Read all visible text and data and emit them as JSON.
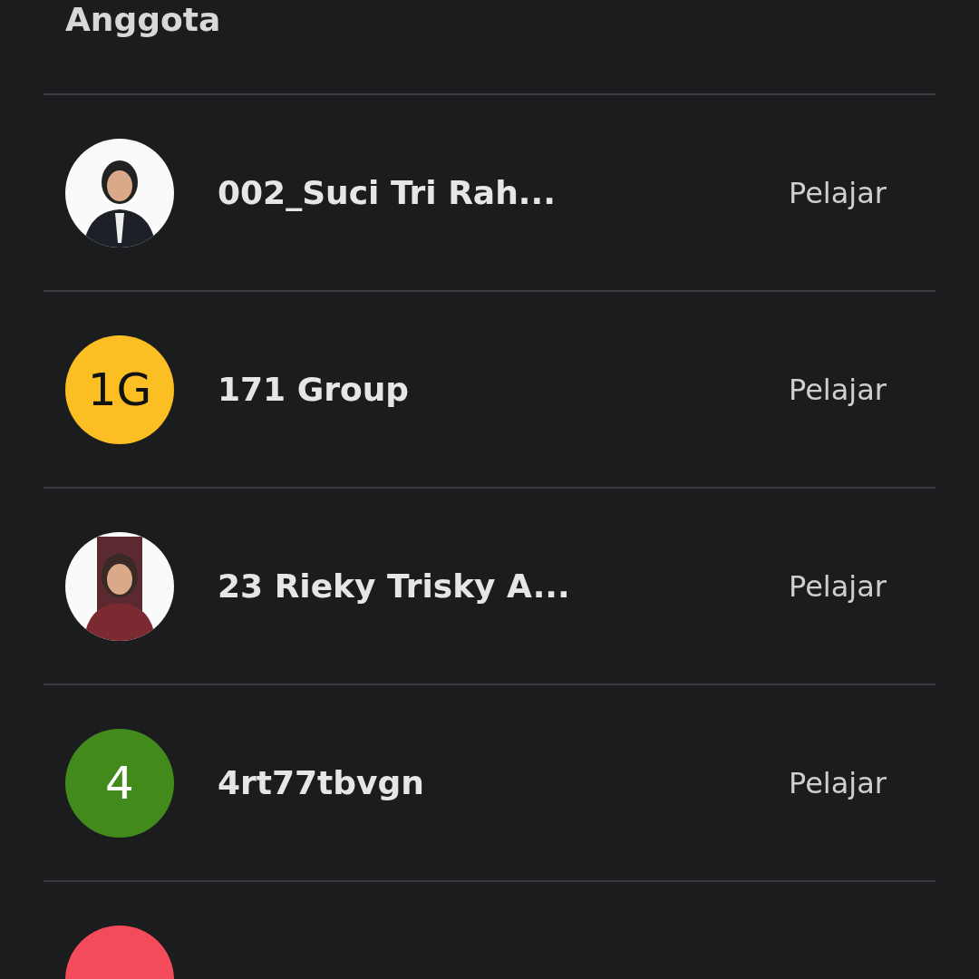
{
  "section_title": "Anggota",
  "members": [
    {
      "name": "002_Suci Tri Rah...",
      "role": "Pelajar"
    },
    {
      "kind": "initials",
      "initials": "1G",
      "color": "#fbbf24",
      "dark_text": true,
      "name": "171 Group",
      "role": "Pelajar"
    },
    {
      "name": "23 Rieky Trisky A...",
      "role": "Pelajar"
    },
    {
      "kind": "initials",
      "initials": "4",
      "color": "#428a1c",
      "dark_text": false,
      "name": "4rt77tbvgn",
      "role": "Pelajar"
    },
    {
      "kind": "blank",
      "color": "#f44b5a"
    }
  ]
}
